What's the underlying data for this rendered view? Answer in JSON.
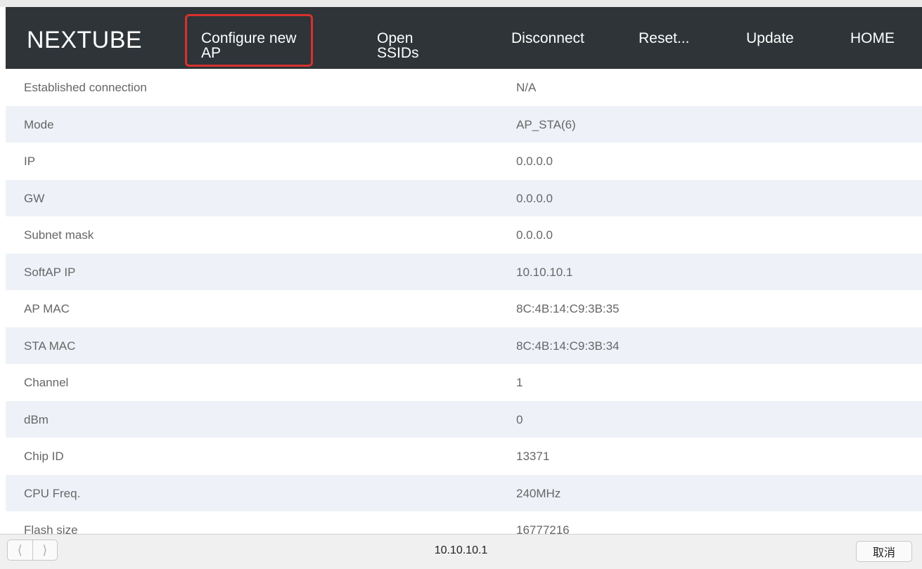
{
  "navbar": {
    "brand": "NEXTUBE",
    "items": [
      {
        "label": "Configure new AP"
      },
      {
        "label": "Open SSIDs"
      },
      {
        "label": "Disconnect"
      },
      {
        "label": "Reset..."
      },
      {
        "label": "Update"
      },
      {
        "label": "HOME"
      }
    ],
    "background": "#2e3438",
    "highlight_color": "#d8312d"
  },
  "info_table": {
    "rows": [
      {
        "label": "Established connection",
        "value": "N/A"
      },
      {
        "label": "Mode",
        "value": "AP_STA(6)"
      },
      {
        "label": "IP",
        "value": "0.0.0.0"
      },
      {
        "label": "GW",
        "value": "0.0.0.0"
      },
      {
        "label": "Subnet mask",
        "value": "0.0.0.0"
      },
      {
        "label": "SoftAP IP",
        "value": "10.10.10.1"
      },
      {
        "label": "AP MAC",
        "value": "8C:4B:14:C9:3B:35"
      },
      {
        "label": "STA MAC",
        "value": "8C:4B:14:C9:3B:34"
      },
      {
        "label": "Channel",
        "value": "1"
      },
      {
        "label": "dBm",
        "value": "0"
      },
      {
        "label": "Chip ID",
        "value": "13371"
      },
      {
        "label": "CPU Freq.",
        "value": "240MHz"
      },
      {
        "label": "Flash size",
        "value": "16777216"
      }
    ],
    "stripe_color": "#eef2f8"
  },
  "bottom_bar": {
    "back_icon": "chevron-left-icon",
    "forward_icon": "chevron-right-icon",
    "url": "10.10.10.1",
    "cancel_label": "取消"
  }
}
